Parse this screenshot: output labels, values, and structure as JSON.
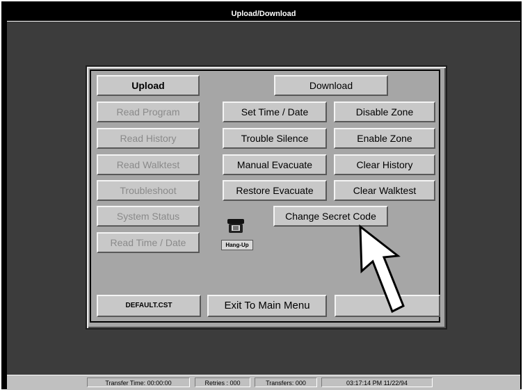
{
  "window": {
    "title": "Upload/Download"
  },
  "left_column": {
    "upload": "Upload",
    "read_program": "Read Program",
    "read_history": "Read History",
    "read_walktest": "Read Walktest",
    "troubleshoot": "Troubleshoot",
    "system_status": "System Status",
    "read_time_date": "Read Time / Date"
  },
  "commands": {
    "download": "Download",
    "set_time_date": "Set Time / Date",
    "disable_zone": "Disable Zone",
    "trouble_silence": "Trouble Silence",
    "enable_zone": "Enable Zone",
    "manual_evacuate": "Manual Evacuate",
    "clear_history": "Clear History",
    "restore_evacuate": "Restore Evacuate",
    "clear_walktest": "Clear Walktest",
    "change_secret_code": "Change Secret Code"
  },
  "phone": {
    "icon": "telephone-icon",
    "label": "Hang-Up"
  },
  "bottom": {
    "file": "DEFAULT.CST",
    "exit": "Exit To Main Menu",
    "blank": ""
  },
  "status": {
    "transfer_time": "Transfer Time: 00:00:00",
    "retries": "Retries : 000",
    "transfers": "Transfers: 000",
    "datetime": "03:17:14 PM 11/22/94"
  },
  "colors": {
    "desktop": "#3c3c3c",
    "panel": "#a6a6a6",
    "button": "#c8c8c8",
    "title_bar": "#000000"
  }
}
